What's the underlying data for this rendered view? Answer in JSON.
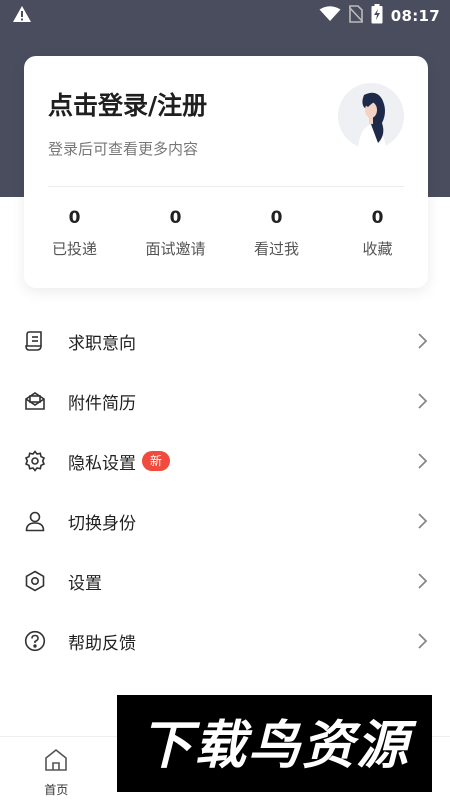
{
  "status_bar": {
    "time": "08:17",
    "icons": [
      "warning-icon",
      "wifi-icon",
      "no-sim-icon",
      "battery-charging-icon"
    ]
  },
  "profile": {
    "title": "点击登录/注册",
    "subtitle": "登录后可查看更多内容",
    "avatar_icon": "avatar-illustration"
  },
  "stats": [
    {
      "value": "0",
      "label": "已投递"
    },
    {
      "value": "0",
      "label": "面试邀请"
    },
    {
      "value": "0",
      "label": "看过我"
    },
    {
      "value": "0",
      "label": "收藏"
    }
  ],
  "menu": [
    {
      "label": "求职意向",
      "icon": "resume-icon"
    },
    {
      "label": "附件简历",
      "icon": "mail-icon"
    },
    {
      "label": "隐私设置",
      "icon": "gear-icon",
      "badge": "新"
    },
    {
      "label": "切换身份",
      "icon": "person-icon"
    },
    {
      "label": "设置",
      "icon": "hexagon-settings-icon"
    },
    {
      "label": "帮助反馈",
      "icon": "help-icon"
    }
  ],
  "tabs": [
    {
      "label": "首页",
      "icon": "home-icon"
    },
    {
      "label": "",
      "icon": ""
    },
    {
      "label": "",
      "icon": ""
    },
    {
      "label": "",
      "icon": ""
    }
  ],
  "watermark": {
    "text": "下载鸟资源"
  },
  "colors": {
    "header_bg": "#4a4d5e",
    "badge": "#f04b3c",
    "active_tab": "#f04b3c"
  }
}
